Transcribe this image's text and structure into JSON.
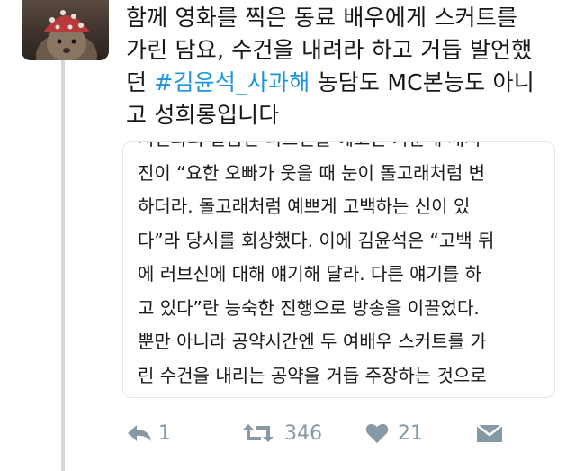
{
  "tweet": {
    "lines": [
      "함께 영화를 찍은 동료 배우에게 스커트를",
      "가린 담요, 수건을 내려라 하고 거듭 발언했"
    ],
    "line3_prefix": "던 ",
    "hashtag": "#김윤석_사과해",
    "line3_suffix": " 농담도 MC본능도 아니",
    "line4": "고 성희롱입니다"
  },
  "card": {
    "lines": [
      "서신과의 날씀안 러브신을 예고안 가운네 새서",
      "진이 “요한 오빠가 웃을 때 눈이 돌고래처럼 변",
      "하더라. 돌고래처럼 예쁘게 고백하는 신이 있",
      "다”라 당시를 회상했다. 이에 김윤석은 “고백 뒤",
      "에 러브신에 대해 얘기해 달라. 다른 얘기를 하",
      "고 있다”란 능숙한 진행으로 방송을 이끌었다.",
      "뿐만 아니라 공약시간엔 두 여배우 스커트를 가",
      "린 수건을 내리는 공약을 거듭 주장하는 것으로"
    ]
  },
  "actions": {
    "reply_count": "1",
    "retweet_count": "346",
    "like_count": "21"
  },
  "colors": {
    "hashtag": "#1b95e0",
    "icon": "#8899a6",
    "thread_line": "#cfd9de"
  },
  "icons": [
    "reply-icon",
    "retweet-icon",
    "heart-icon",
    "direct-message-icon"
  ]
}
